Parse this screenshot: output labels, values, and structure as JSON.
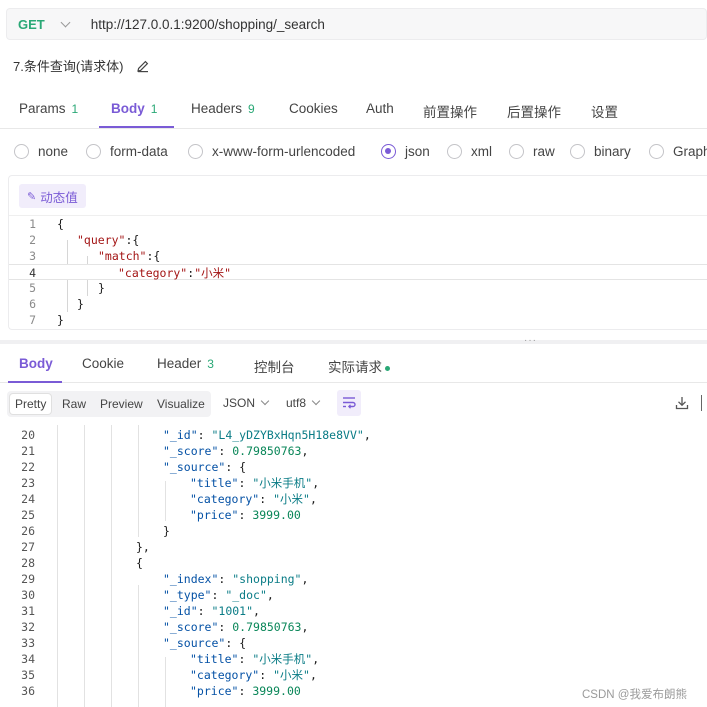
{
  "request": {
    "method": "GET",
    "url": "http://127.0.0.1:9200/shopping/_search",
    "name": "7.条件查询(请求体)"
  },
  "request_tabs": [
    {
      "label": "Params",
      "count": "1"
    },
    {
      "label": "Body",
      "count": "1"
    },
    {
      "label": "Headers",
      "count": "9"
    },
    {
      "label": "Cookies",
      "count": ""
    },
    {
      "label": "Auth",
      "count": ""
    },
    {
      "label": "前置操作",
      "count": ""
    },
    {
      "label": "后置操作",
      "count": ""
    },
    {
      "label": "设置",
      "count": ""
    }
  ],
  "body_types": [
    "none",
    "form-data",
    "x-www-form-urlencoded",
    "json",
    "xml",
    "raw",
    "binary",
    "GraphQL"
  ],
  "selected_body_type": "json",
  "dynamic_value_label": "动态值",
  "request_body": {
    "line_numbers": [
      "1",
      "2",
      "3",
      "4",
      "5",
      "6",
      "7"
    ],
    "open_brace": "{",
    "query_key": "\"query\"",
    "match_key": "\"match\"",
    "category_key": "\"category\"",
    "category_value": "\"小米\"",
    "colon_brace": ":{",
    "colon": ":",
    "close_brace": "}"
  },
  "response_tabs": [
    {
      "label": "Body",
      "count": ""
    },
    {
      "label": "Cookie",
      "count": ""
    },
    {
      "label": "Header",
      "count": "3"
    },
    {
      "label": "控制台",
      "count": ""
    },
    {
      "label": "实际请求",
      "count": ""
    }
  ],
  "view_modes": [
    "Pretty",
    "Raw",
    "Preview",
    "Visualize"
  ],
  "format_select": "JSON",
  "encoding_select": "utf8",
  "response_lines": [
    {
      "n": "20",
      "k": "\"_id\"",
      "v": "\"L4_yDZYBxHqn5H18e8VV\"",
      "t": "s",
      "end": ","
    },
    {
      "n": "21",
      "k": "\"_score\"",
      "v": "0.79850763",
      "t": "n",
      "end": ","
    },
    {
      "n": "22",
      "k": "\"_source\"",
      "v": "{",
      "t": "p",
      "end": ""
    },
    {
      "n": "23",
      "k": "\"title\"",
      "v": "\"小米手机\"",
      "t": "s",
      "end": ","
    },
    {
      "n": "24",
      "k": "\"category\"",
      "v": "\"小米\"",
      "t": "s",
      "end": ","
    },
    {
      "n": "25",
      "k": "\"price\"",
      "v": "3999.00",
      "t": "n",
      "end": ""
    },
    {
      "n": "26",
      "k": "",
      "v": "}",
      "t": "p",
      "end": ""
    },
    {
      "n": "27",
      "k": "",
      "v": "},",
      "t": "p",
      "end": ""
    },
    {
      "n": "28",
      "k": "",
      "v": "{",
      "t": "p",
      "end": ""
    },
    {
      "n": "29",
      "k": "\"_index\"",
      "v": "\"shopping\"",
      "t": "s",
      "end": ","
    },
    {
      "n": "30",
      "k": "\"_type\"",
      "v": "\"_doc\"",
      "t": "s",
      "end": ","
    },
    {
      "n": "31",
      "k": "\"_id\"",
      "v": "\"1001\"",
      "t": "s",
      "end": ","
    },
    {
      "n": "32",
      "k": "\"_score\"",
      "v": "0.79850763",
      "t": "n",
      "end": ","
    },
    {
      "n": "33",
      "k": "\"_source\"",
      "v": "{",
      "t": "p",
      "end": ""
    },
    {
      "n": "34",
      "k": "\"title\"",
      "v": "\"小米手机\"",
      "t": "s",
      "end": ","
    },
    {
      "n": "35",
      "k": "\"category\"",
      "v": "\"小米\"",
      "t": "s",
      "end": ","
    },
    {
      "n": "36",
      "k": "\"price\"",
      "v": "3999.00",
      "t": "n",
      "end": ""
    }
  ],
  "watermark": "CSDN @我爱布朗熊",
  "icons": [
    "chevron-down-icon",
    "edit-icon",
    "magic-wand-icon",
    "wrap-lines-icon",
    "download-icon",
    "more-icon"
  ],
  "colors": {
    "accent": "#7a5bd6",
    "method": "#2aa876",
    "count": "#2aa876"
  }
}
